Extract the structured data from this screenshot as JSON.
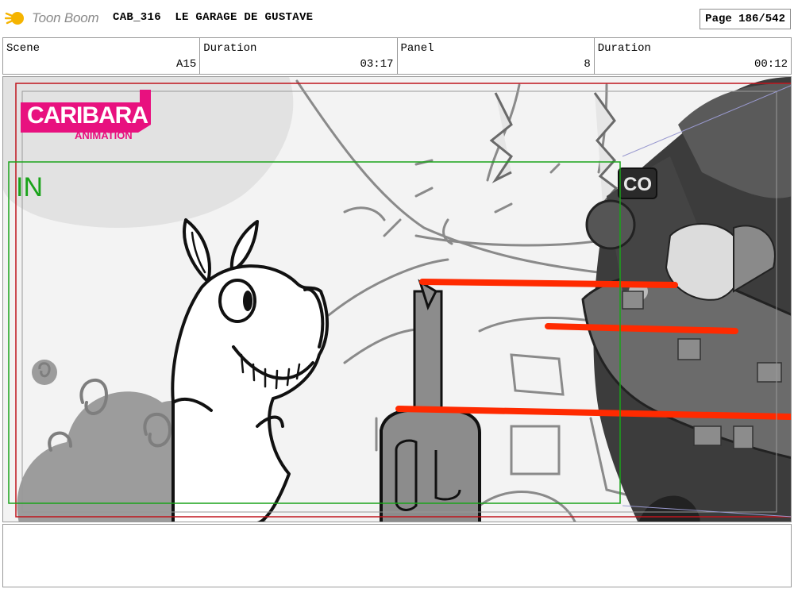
{
  "header": {
    "brand": "Toon Boom",
    "project_code": "CAB_316",
    "episode_title": "LE GARAGE DE GUSTAVE",
    "page_indicator": "Page 186/542"
  },
  "fields": [
    {
      "label": "Scene",
      "value": "A15"
    },
    {
      "label": "Duration",
      "value": "03:17"
    },
    {
      "label": "Panel",
      "value": "8"
    },
    {
      "label": "Duration",
      "value": "00:12"
    }
  ],
  "panel": {
    "logo_text": "CARIBARA",
    "logo_subtext": "ANIMATION",
    "in_frame_label": "IN",
    "sign_text": "CO",
    "colors": {
      "in_frame": "#1aa31a",
      "out_frame": "#c0141c",
      "logo": "#e8117f",
      "speed_lines": "#ff2a00"
    }
  },
  "icons": {
    "brand": "toon-boom-star-icon"
  }
}
